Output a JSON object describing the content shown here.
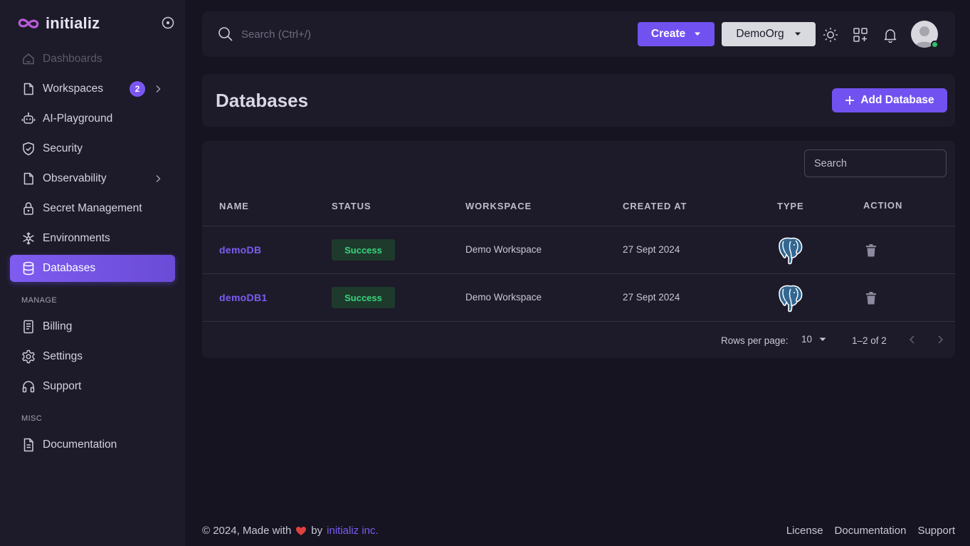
{
  "brand": {
    "name": "initializ"
  },
  "sidebar": {
    "items": [
      {
        "label": "Dashboards"
      },
      {
        "label": "Workspaces",
        "badge": "2"
      },
      {
        "label": "AI-Playground"
      },
      {
        "label": "Security"
      },
      {
        "label": "Observability"
      },
      {
        "label": "Secret Management"
      },
      {
        "label": "Environments"
      },
      {
        "label": "Databases"
      }
    ],
    "manage_label": "MANAGE",
    "manage_items": [
      {
        "label": "Billing"
      },
      {
        "label": "Settings"
      },
      {
        "label": "Support"
      }
    ],
    "misc_label": "MISC",
    "misc_items": [
      {
        "label": "Documentation"
      }
    ]
  },
  "topbar": {
    "search_placeholder": "Search (Ctrl+/)",
    "create_label": "Create",
    "org_label": "DemoOrg"
  },
  "page": {
    "title": "Databases",
    "add_label": "Add Database"
  },
  "table": {
    "search_placeholder": "Search",
    "columns": [
      "NAME",
      "STATUS",
      "WORKSPACE",
      "CREATED AT",
      "TYPE",
      "ACTION"
    ],
    "rows": [
      {
        "name": "demoDB",
        "status": "Success",
        "workspace": "Demo Workspace",
        "created_at": "27 Sept 2024",
        "type_icon": "postgresql-icon"
      },
      {
        "name": "demoDB1",
        "status": "Success",
        "workspace": "Demo Workspace",
        "created_at": "27 Sept 2024",
        "type_icon": "postgresql-icon"
      }
    ],
    "rows_per_page_label": "Rows per page:",
    "rows_per_page": "10",
    "range": "1–2 of 2"
  },
  "footer": {
    "prefix": "© 2024, Made with",
    "by": "by",
    "company": "initializ inc.",
    "links": [
      "License",
      "Documentation",
      "Support"
    ]
  },
  "colors": {
    "accent": "#7152f0",
    "success": "#3bd37c",
    "background": "#161421",
    "panel": "#1d1b29"
  }
}
